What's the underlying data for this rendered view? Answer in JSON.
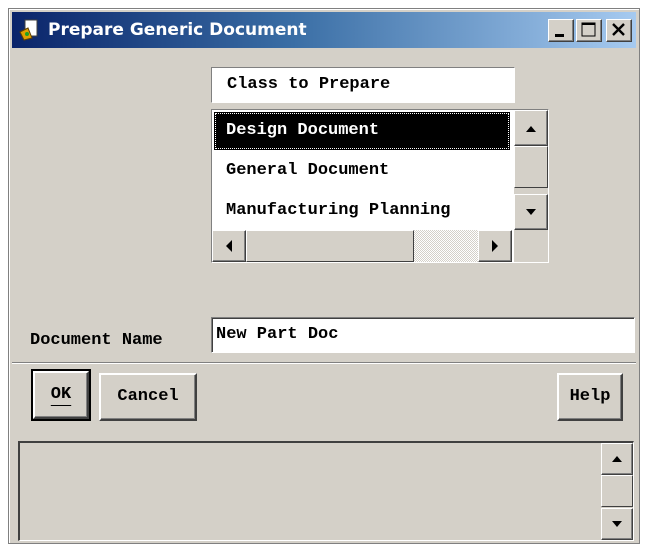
{
  "window": {
    "title": "Prepare Generic Document",
    "controls": [
      "minimize-icon",
      "maximize-icon",
      "close-icon"
    ]
  },
  "class_list": {
    "header": "Class to Prepare",
    "items": [
      {
        "label": "Design Document",
        "selected": true
      },
      {
        "label": "General Document",
        "selected": false
      },
      {
        "label": "Manufacturing Planning",
        "selected": false
      }
    ]
  },
  "document_name": {
    "label": "Document Name",
    "value": "New Part Doc"
  },
  "buttons": {
    "ok": "OK",
    "cancel": "Cancel",
    "help": "Help"
  },
  "colors": {
    "face": "#d4d0c8",
    "title_start": "#0a246a",
    "title_end": "#a6caf0",
    "selection": "#000000"
  }
}
